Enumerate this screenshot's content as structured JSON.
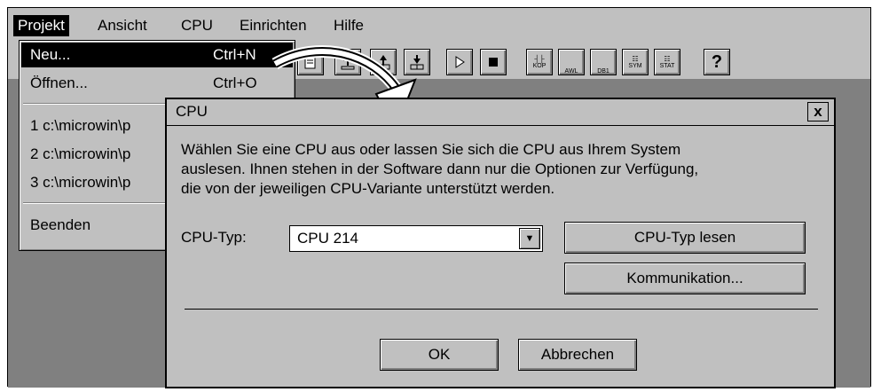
{
  "menubar": {
    "items": [
      {
        "label": "Projekt"
      },
      {
        "label": "Ansicht"
      },
      {
        "label": "CPU"
      },
      {
        "label": "Einrichten"
      },
      {
        "label": "Hilfe"
      }
    ]
  },
  "toolbar": {
    "icons": [
      "new-icon",
      "upload-icon",
      "upload-icon",
      "download-icon",
      "run-icon",
      "stop-icon",
      "kop-icon",
      "awl-icon",
      "db1-icon",
      "sym-icon",
      "stat-icon",
      "help-icon"
    ],
    "kop_label": "KOP",
    "awl_label": "AWL",
    "db1_label": "DB1",
    "sym_label": "SYM",
    "stat_label": "STAT",
    "help_label": "?"
  },
  "project_menu": {
    "new_label": "Neu...",
    "new_accel": "Ctrl+N",
    "open_label": "Öffnen...",
    "open_accel": "Ctrl+O",
    "recent": [
      "1  c:\\microwin\\p",
      "2  c:\\microwin\\p",
      "3  c:\\microwin\\p"
    ],
    "exit_label": "Beenden"
  },
  "dialog": {
    "title": "CPU",
    "close_label": "x",
    "description": [
      "Wählen Sie eine CPU aus oder lassen Sie sich die CPU aus Ihrem System",
      "auslesen. Ihnen stehen in der Software dann nur die Optionen zur Verfügung,",
      "die von der jeweiligen CPU-Variante unterstützt werden."
    ],
    "cpu_type_label": "CPU-Typ:",
    "cpu_type_value": "CPU 214",
    "read_button": "CPU-Typ lesen",
    "comm_button": "Kommunikation...",
    "ok_button": "OK",
    "cancel_button": "Abbrechen"
  },
  "colors": {
    "window_bg": "#c0c0c0",
    "workspace_bg": "#808080",
    "highlight": "#000000"
  }
}
